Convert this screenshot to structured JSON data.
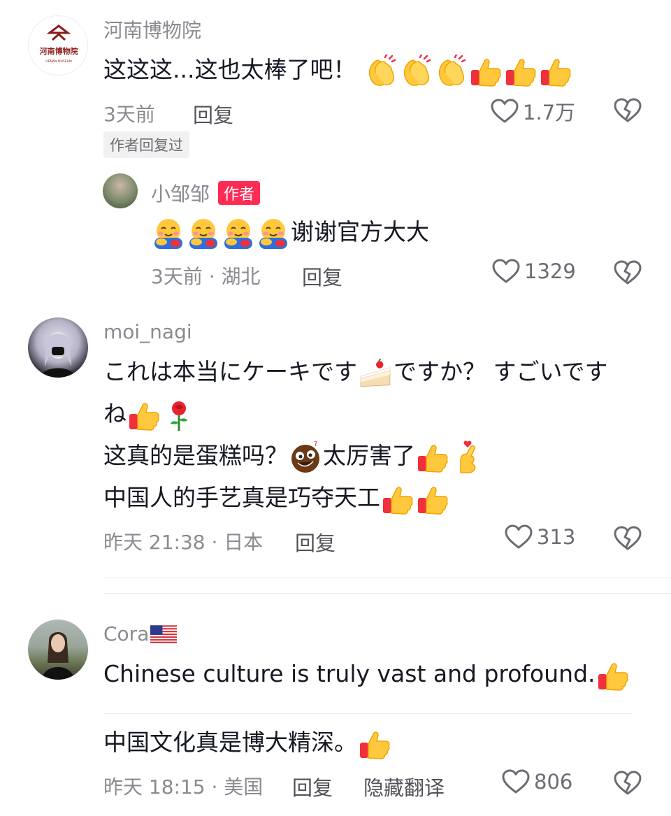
{
  "comments": [
    {
      "author": "河南博物院",
      "avatar_text": "河南博物院",
      "avatar_sub": "HENAN MUSEUM",
      "text": "这这这...这也太棒了吧！",
      "time": "3天前",
      "reply_label": "回复",
      "likes": "1.7万",
      "author_replied": "作者回复过",
      "replies": [
        {
          "author": "小邹邹",
          "author_badge": "作者",
          "text": "谢谢官方大大",
          "time": "3天前 · 湖北",
          "reply_label": "回复",
          "likes": "1329"
        }
      ]
    },
    {
      "author": "moi_nagi",
      "text_line1": "これは本当にケーキです",
      "text_line1b": "ですか？ すごいです",
      "text_line2": "ね",
      "text_line3a": "这真的是蛋糕吗？",
      "text_line3b": "太厉害了",
      "text_line4": "中国人的手艺真是巧夺天工",
      "time": "昨天 21:38 · 日本",
      "reply_label": "回复",
      "likes": "313"
    },
    {
      "author": "Cora",
      "text": "Chinese culture is truly vast and profound.",
      "translation": "中国文化真是博大精深。",
      "time": "昨天 18:15 · 美国",
      "reply_label": "回复",
      "hide_translation": "隐藏翻译",
      "likes": "806"
    }
  ],
  "icons": [
    "heart-outline-icon",
    "broken-heart-icon",
    "clap-emoji",
    "thumbs-up-emoji",
    "hug-emoji",
    "cake-emoji",
    "rose-emoji",
    "dizzy-face-emoji",
    "finger-heart-emoji",
    "us-flag-emoji"
  ],
  "colors": {
    "accent": "#fe2c55",
    "meta": "#8a8b91",
    "text": "#161823"
  }
}
